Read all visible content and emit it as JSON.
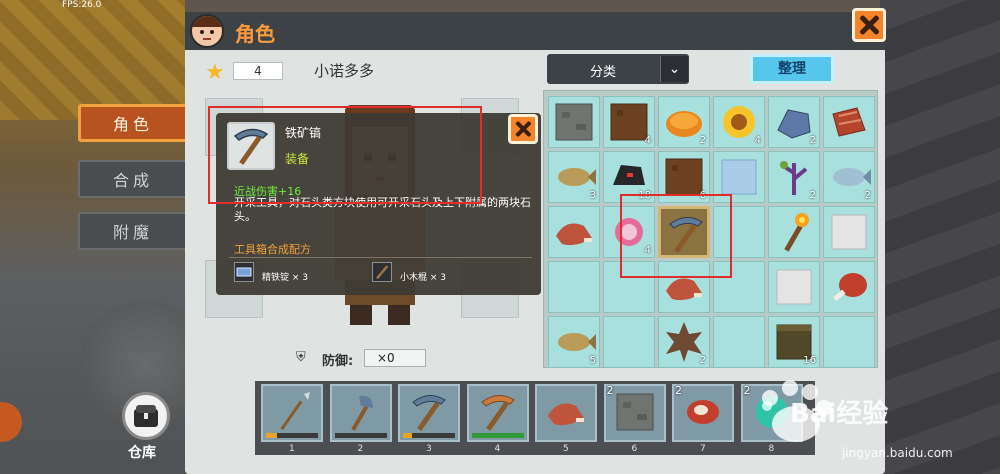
{
  "hud": {
    "fps": "FPS:26.0"
  },
  "side_tabs": [
    {
      "label": "角色",
      "active": true
    },
    {
      "label": "合成",
      "active": false
    },
    {
      "label": "附魔",
      "active": false
    }
  ],
  "warehouse": {
    "label": "仓库"
  },
  "panel": {
    "title": "角色",
    "close_icon": "close-icon"
  },
  "player": {
    "level": "4",
    "name": "小诺多多"
  },
  "category": {
    "label": "分类",
    "arrow": "⌄"
  },
  "sort_button": {
    "label": "整理"
  },
  "defense": {
    "label": "防御:",
    "value": "×0"
  },
  "tooltip": {
    "item_name": "铁矿镐",
    "type": "装备",
    "damage": "近战伤害+16",
    "description": "开采工具，对石头类方块使用可开采石头及上下附属的两块石头。",
    "recipe_title": "工具箱合成配方",
    "materials": [
      {
        "name": "精铁锭 × 3"
      },
      {
        "name": "小木棍 × 3"
      }
    ]
  },
  "inventory": {
    "rows": [
      [
        {
          "item": "stone",
          "count": ""
        },
        {
          "item": "dirt",
          "count": "4"
        },
        {
          "item": "bread",
          "count": "2"
        },
        {
          "item": "sunflower",
          "count": "4"
        },
        {
          "item": "iron-ore",
          "count": "2"
        },
        {
          "item": "meat",
          "count": ""
        }
      ],
      [
        {
          "item": "fish",
          "count": "3"
        },
        {
          "item": "coal",
          "count": "18"
        },
        {
          "item": "dirt",
          "count": "6"
        },
        {
          "item": "ice",
          "count": ""
        },
        {
          "item": "plant",
          "count": "2"
        },
        {
          "item": "fish-blue",
          "count": "2"
        }
      ],
      [
        {
          "item": "ham",
          "count": ""
        },
        {
          "item": "candy",
          "count": "4"
        },
        {
          "item": "pickaxe",
          "count": "",
          "selected": true
        },
        {
          "item": "",
          "count": ""
        },
        {
          "item": "torch",
          "count": ""
        },
        {
          "item": "white-block",
          "count": ""
        }
      ],
      [
        {
          "item": "",
          "count": ""
        },
        {
          "item": "",
          "count": ""
        },
        {
          "item": "ham",
          "count": ""
        },
        {
          "item": "",
          "count": ""
        },
        {
          "item": "white-block",
          "count": ""
        },
        {
          "item": "meat-leg",
          "count": ""
        }
      ],
      [
        {
          "item": "fish",
          "count": "5"
        },
        {
          "item": "",
          "count": ""
        },
        {
          "item": "spiky",
          "count": "2"
        },
        {
          "item": "",
          "count": ""
        },
        {
          "item": "wood-block",
          "count": "16"
        },
        {
          "item": "",
          "count": ""
        }
      ]
    ]
  },
  "hotbar": [
    {
      "num": "1",
      "count": "",
      "item": "spear",
      "durability": 0.22,
      "dur_color": "#e9a31f"
    },
    {
      "num": "2",
      "count": "",
      "item": "axe",
      "durability": 0,
      "dur_color": "#e9a31f"
    },
    {
      "num": "3",
      "count": "",
      "item": "pickaxe",
      "durability": 0.18,
      "dur_color": "#e9a31f"
    },
    {
      "num": "4",
      "count": "",
      "item": "copper-pickaxe",
      "durability": 1.0,
      "dur_color": "#2f9c3a"
    },
    {
      "num": "5",
      "count": "",
      "item": "ham",
      "durability": 0,
      "dur_color": ""
    },
    {
      "num": "6",
      "count": "2",
      "item": "stone",
      "durability": 0,
      "dur_color": ""
    },
    {
      "num": "7",
      "count": "2",
      "item": "steak",
      "durability": 0,
      "dur_color": ""
    },
    {
      "num": "8",
      "count": "2",
      "item": "orb",
      "durability": 0,
      "dur_color": ""
    }
  ],
  "watermark": {
    "brand": "Bai经验",
    "url": "jingyan.baidu.com"
  }
}
